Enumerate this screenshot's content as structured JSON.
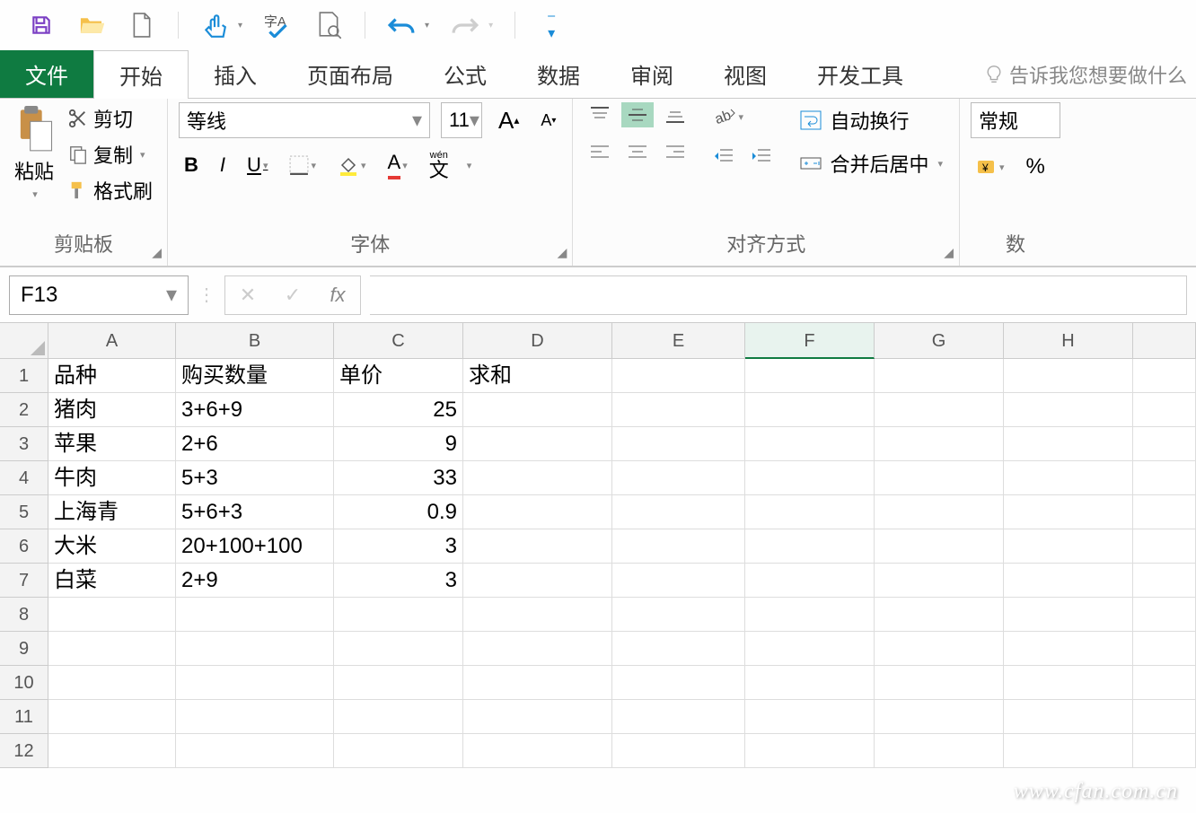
{
  "qat": {
    "dropdown": "▾"
  },
  "ribbonTabs": {
    "file": "文件",
    "home": "开始",
    "insert": "插入",
    "layout": "页面布局",
    "formula": "公式",
    "data": "数据",
    "review": "审阅",
    "view": "视图",
    "dev": "开发工具",
    "hint": "告诉我您想要做什么"
  },
  "ribbon": {
    "clipboard": {
      "paste": "粘贴",
      "cut": "剪切",
      "copy": "复制",
      "painter": "格式刷",
      "label": "剪贴板"
    },
    "font": {
      "name": "等线",
      "size": "11",
      "label": "字体",
      "phonetic": "wén"
    },
    "align": {
      "wrap": "自动换行",
      "merge": "合并后居中",
      "label": "对齐方式"
    },
    "number": {
      "format": "常规",
      "label": "数"
    }
  },
  "namebox": {
    "ref": "F13",
    "fx": "fx"
  },
  "columns": [
    "A",
    "B",
    "C",
    "D",
    "E",
    "F",
    "G",
    "H",
    ""
  ],
  "rowCount": 12,
  "selectedCell": "F13",
  "headers": {
    "A": "品种",
    "B": "购买数量",
    "C": "单价",
    "D": "求和"
  },
  "rows": [
    {
      "A": "猪肉",
      "B": "3+6+9",
      "C": "25"
    },
    {
      "A": "苹果",
      "B": "2+6",
      "C": "9"
    },
    {
      "A": "牛肉",
      "B": "5+3",
      "C": "33"
    },
    {
      "A": "上海青",
      "B": "5+6+3",
      "C": "0.9"
    },
    {
      "A": "大米",
      "B": "20+100+100",
      "C": "3"
    },
    {
      "A": "白菜",
      "B": "2+9",
      "C": "3"
    }
  ],
  "watermark": "www.cfan.com.cn"
}
